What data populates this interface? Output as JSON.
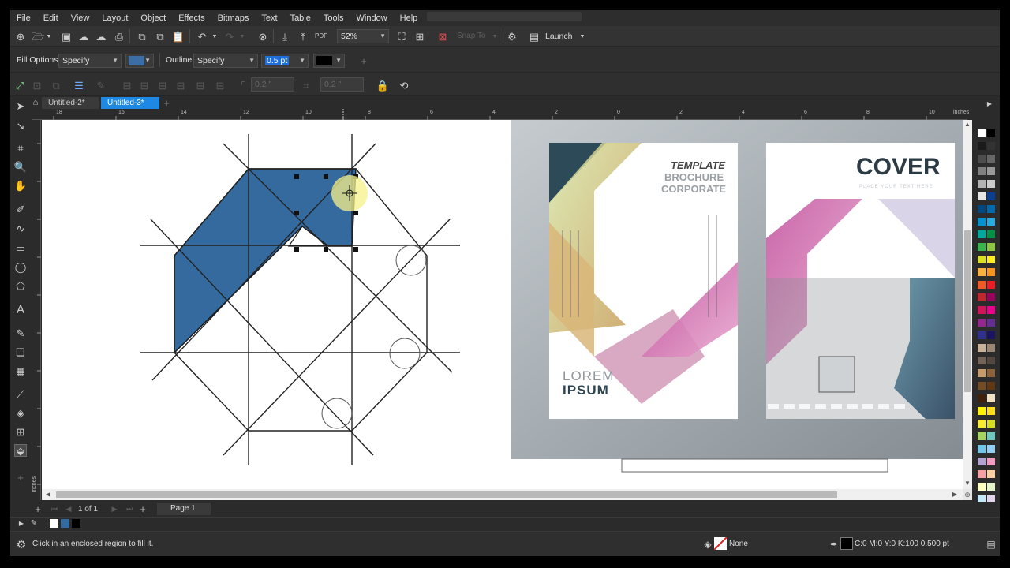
{
  "menu": [
    "File",
    "Edit",
    "View",
    "Layout",
    "Object",
    "Effects",
    "Bitmaps",
    "Text",
    "Table",
    "Tools",
    "Window",
    "Help"
  ],
  "standard_toolbar": {
    "zoom_value": "52%",
    "snap_to_label": "Snap To",
    "launch_label": "Launch"
  },
  "property_bar": {
    "fill_options_label": "Fill Options:",
    "fill_options_value": "Specify",
    "fill_color": "#3b6ea5",
    "outline_label": "Outline:",
    "outline_value": "Specify",
    "outline_width": "0.5 pt",
    "outline_color": "#000000"
  },
  "property_bar2": {
    "angle1": "0.2 \"",
    "angle2": "0.2 \""
  },
  "tabs": [
    {
      "label": "Untitled-2*",
      "active": false
    },
    {
      "label": "Untitled-3*",
      "active": true
    }
  ],
  "rulers": {
    "h_numbers": [
      "18",
      "16",
      "14",
      "12",
      "10",
      "8",
      "6",
      "4",
      "2",
      "0",
      "2",
      "4",
      "6",
      "8",
      "10"
    ],
    "unit": "inches",
    "v_unit": "inches"
  },
  "drawing": {
    "fill_color": "#356a9f",
    "stroke_color": "#1a1a1a"
  },
  "brochure_left": {
    "title_line1": "TEMPLATE",
    "title_line2": "BROCHURE",
    "title_line3": "CORPORATE",
    "footer_line1": "LOREM",
    "footer_line2": "IPSUM"
  },
  "brochure_right": {
    "title": "COVER",
    "subtitle": "PLACE YOUR TEXT HERE"
  },
  "page_nav": {
    "page_count": "1 of 1",
    "page_tab": "Page 1"
  },
  "status": {
    "message": "Click in an enclosed region to fill it.",
    "fill_label": "None",
    "outline_info": "C:0 M:0 Y:0 K:100  0.500 pt"
  },
  "palette_colors": [
    "#ffffff",
    "#000000",
    "#1a1a1a",
    "#333333",
    "#4d4d4d",
    "#666666",
    "#808080",
    "#999999",
    "#b3b3b3",
    "#cccccc",
    "#e6e6e6",
    "#0b3d91",
    "#00467f",
    "#006ab0",
    "#0093d0",
    "#29abe2",
    "#00a99d",
    "#009245",
    "#39b54a",
    "#8cc63f",
    "#d9e021",
    "#fcee21",
    "#fbb03b",
    "#f7931e",
    "#f15a24",
    "#ed1c24",
    "#c1272d",
    "#9e005d",
    "#d4145a",
    "#ec008c",
    "#93278f",
    "#662d91",
    "#2e3192",
    "#1b1464",
    "#c7b299",
    "#998675",
    "#736357",
    "#534741",
    "#c69c6d",
    "#8c6239",
    "#754c24",
    "#603813",
    "#42210b",
    "#f2e2c4",
    "#fff200",
    "#ffde17",
    "#f9ed32",
    "#d7df23",
    "#a3d55f",
    "#6dc8bf",
    "#71c5e8",
    "#92d1f2",
    "#b3a2d0",
    "#f49ac1",
    "#f6a0a1",
    "#fcd0a1",
    "#ffffbe",
    "#e6f5c9",
    "#c4e8f7",
    "#e0d5ec"
  ]
}
